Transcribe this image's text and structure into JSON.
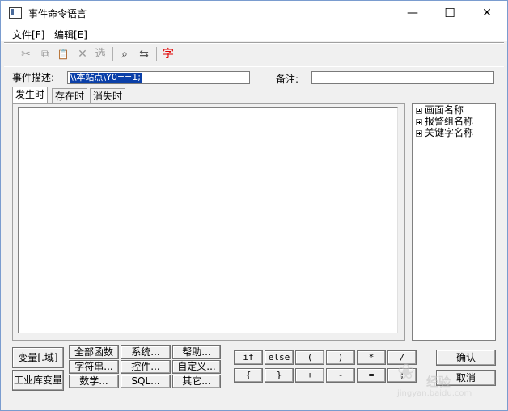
{
  "window": {
    "title": "事件命令语言",
    "minimize": "—",
    "maximize": "☐",
    "close": "✕"
  },
  "menu": {
    "file": "文件[F]",
    "edit": "编辑[E]"
  },
  "toolbar": {
    "cut": "✂",
    "copy": "⧉",
    "paste": "📋",
    "delete": "✕",
    "select": "选",
    "find": "⌕",
    "replace": "⇆",
    "font": "字",
    "font_color": "#e00000"
  },
  "form": {
    "desc_label": "事件描述:",
    "desc_value": "\\\\本站点\\Y0==1;",
    "note_label": "备注:",
    "note_value": ""
  },
  "tabs": [
    {
      "label": "发生时"
    },
    {
      "label": "存在时"
    },
    {
      "label": "消失时"
    }
  ],
  "tree": [
    {
      "label": "画面名称"
    },
    {
      "label": "报警组名称"
    },
    {
      "label": "关键字名称"
    }
  ],
  "buttons": {
    "var_field": "变量[.域]",
    "industrial_var": "工业库变量",
    "all_funcs": "全部函数",
    "string": "字符串...",
    "math": "数学...",
    "system": "系统...",
    "control": "控件...",
    "sql": "SQL...",
    "help": "帮助...",
    "custom": "自定义...",
    "other": "其它...",
    "ok": "确认",
    "cancel": "取消"
  },
  "keys": [
    [
      "if",
      "else",
      "(",
      ")",
      "*",
      "/"
    ],
    [
      "{",
      "}",
      "+",
      "-",
      "=",
      ";"
    ]
  ],
  "watermark": {
    "text": "经验",
    "url": "jingyan.baidu.com"
  }
}
